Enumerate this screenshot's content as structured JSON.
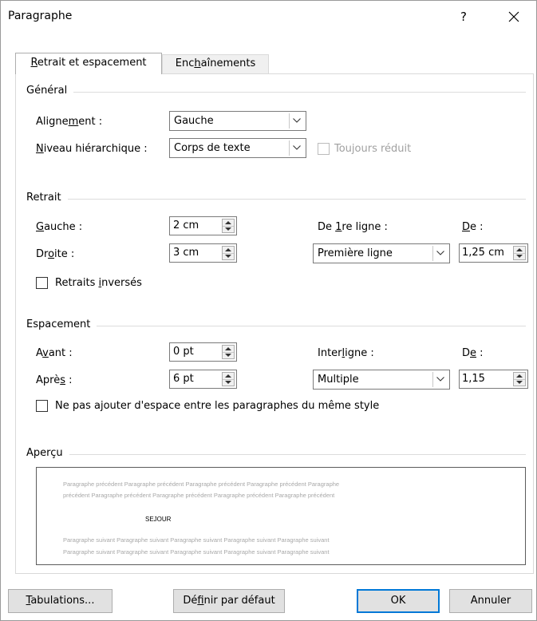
{
  "dialog": {
    "title": "Paragraphe",
    "help": "?"
  },
  "tabs": [
    {
      "label_pre": "",
      "label_u": "R",
      "label_post": "etrait et espacement",
      "active": true
    },
    {
      "label_pre": "Enc",
      "label_u": "h",
      "label_post": "aînements",
      "active": false
    }
  ],
  "general": {
    "title": "Général",
    "alignment_label": {
      "pre": "Aligne",
      "u": "m",
      "post": "ent :"
    },
    "alignment_value": "Gauche",
    "level_label": {
      "pre": "",
      "u": "N",
      "post": "iveau hiérarchique :"
    },
    "level_value": "Corps de texte",
    "collapsed_label": "Toujours réduit"
  },
  "indent": {
    "title": "Retrait",
    "left_label": {
      "pre": "",
      "u": "G",
      "post": "auche :"
    },
    "left_value": "2 cm",
    "right_label": {
      "pre": "Dr",
      "u": "o",
      "post": "ite :"
    },
    "right_value": "3 cm",
    "special_label": {
      "pre": "De ",
      "u": "1",
      "post": "re ligne :"
    },
    "special_value": "Première ligne",
    "by_label": {
      "pre": "",
      "u": "D",
      "post": "e :"
    },
    "by_value": "1,25 cm",
    "mirror_label": {
      "pre": "Retraits ",
      "u": "i",
      "post": "nversés"
    }
  },
  "spacing": {
    "title": "Espacement",
    "before_label": {
      "pre": "A",
      "u": "v",
      "post": "ant :"
    },
    "before_value": "0 pt",
    "after_label": {
      "pre": "Aprè",
      "u": "s",
      "post": " :"
    },
    "after_value": "6 pt",
    "line_label": {
      "pre": "Inter",
      "u": "l",
      "post": "igne :"
    },
    "line_value": "Multiple",
    "at_label": {
      "pre": "D",
      "u": "e",
      "post": " :"
    },
    "at_value": "1,15",
    "nospace_label": {
      "pre": "Ne pas a",
      "u": "j",
      "post": "outer d'espace entre les paragraphes du même style"
    }
  },
  "preview": {
    "title": "Aperçu",
    "prev_line1": "Paragraphe précédent Paragraphe précédent Paragraphe précédent Paragraphe précédent Paragraphe",
    "prev_line2": "précédent Paragraphe précédent Paragraphe précédent Paragraphe précédent Paragraphe précédent",
    "main_text": "SEJOUR",
    "next_line1": "Paragraphe suivant Paragraphe suivant Paragraphe suivant Paragraphe suivant Paragraphe suivant",
    "next_line2": "Paragraphe suivant Paragraphe suivant Paragraphe suivant Paragraphe suivant Paragraphe suivant"
  },
  "buttons": {
    "tabs": {
      "pre": "",
      "u": "T",
      "post": "abulations..."
    },
    "default": {
      "pre": "Dé",
      "u": "f",
      "post": "inir par défaut"
    },
    "ok": "OK",
    "cancel": "Annuler"
  }
}
